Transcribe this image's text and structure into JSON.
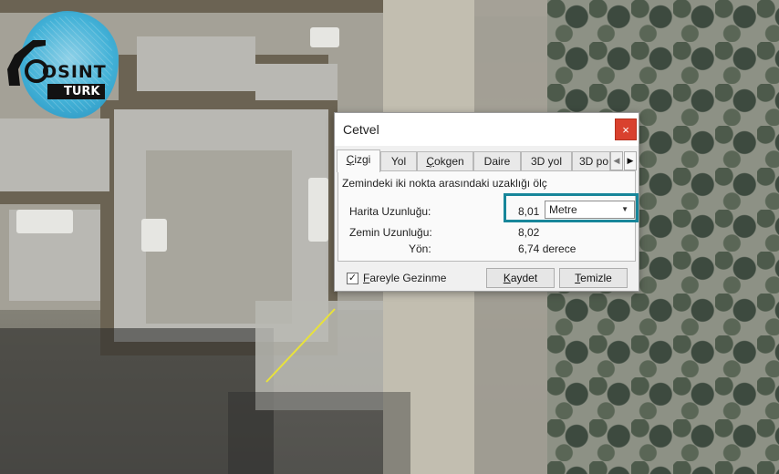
{
  "dialog": {
    "title": "Cetvel",
    "close_glyph": "×",
    "tabs": [
      {
        "label": "Çizgi",
        "accel": "Ç",
        "rest": "izgi",
        "active": true
      },
      {
        "label": "Yol",
        "accel": "",
        "rest": "Yol",
        "active": false
      },
      {
        "label": "Çokgen",
        "accel": "Ç",
        "rest": "okgen",
        "active": false
      },
      {
        "label": "Daire",
        "accel": "",
        "rest": "Daire",
        "active": false
      },
      {
        "label": "3D yol",
        "accel": "",
        "rest": "3D yol",
        "active": false
      },
      {
        "label": "3D po",
        "accel": "",
        "rest": "3D po",
        "active": false
      }
    ],
    "tab_scroll": {
      "left_glyph": "◀",
      "right_glyph": "▶"
    },
    "description": "Zemindeki iki nokta arasındaki uzaklığı ölç",
    "map_length": {
      "label": "Harita Uzunluğu:",
      "value": "8,01",
      "unit": "Metre"
    },
    "ground_length": {
      "label": "Zemin Uzunluğu:",
      "value": "8,02"
    },
    "heading": {
      "label": "Yön:",
      "value": "6,74 derece"
    },
    "mouse_navigation": {
      "accel": "F",
      "rest": "areyle Gezinme",
      "checked": true,
      "check_glyph": "✓"
    },
    "buttons": {
      "save": {
        "accel": "K",
        "rest": "aydet"
      },
      "clear": {
        "accel": "T",
        "rest": "emizle"
      }
    },
    "caret_glyph": "▼"
  },
  "logo": {
    "text_main": "OSINT",
    "text_sub": "TURK"
  },
  "colors": {
    "highlight_box": "#17869a",
    "close_button": "#d9412e",
    "measure_line": "#e8e23a",
    "logo_blue": "#3ab3dd"
  }
}
